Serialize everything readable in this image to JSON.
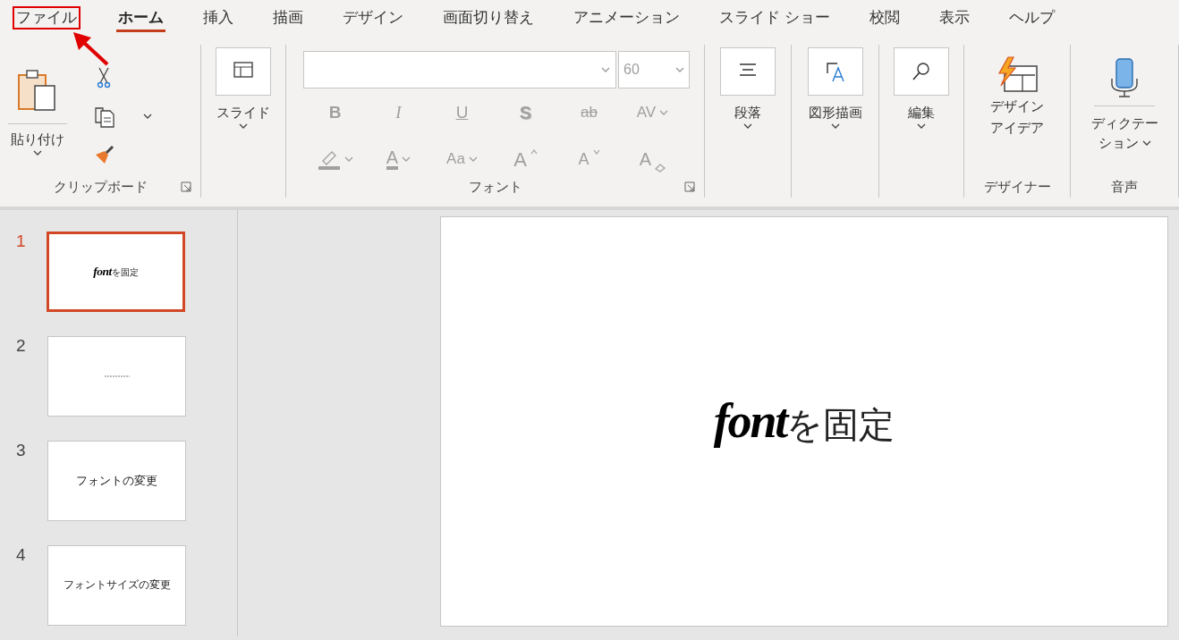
{
  "tabs": [
    {
      "label": "ファイル",
      "selected": false,
      "annotated": true
    },
    {
      "label": "ホーム",
      "selected": true,
      "annotated": false
    },
    {
      "label": "挿入",
      "selected": false,
      "annotated": false
    },
    {
      "label": "描画",
      "selected": false,
      "annotated": false
    },
    {
      "label": "デザイン",
      "selected": false,
      "annotated": false
    },
    {
      "label": "画面切り替え",
      "selected": false,
      "annotated": false
    },
    {
      "label": "アニメーション",
      "selected": false,
      "annotated": false
    },
    {
      "label": "スライド ショー",
      "selected": false,
      "annotated": false
    },
    {
      "label": "校閲",
      "selected": false,
      "annotated": false
    },
    {
      "label": "表示",
      "selected": false,
      "annotated": false
    },
    {
      "label": "ヘルプ",
      "selected": false,
      "annotated": false
    }
  ],
  "ribbon": [
    {
      "kind": "clipboard",
      "label": "クリップボード",
      "button": "貼り付け"
    },
    {
      "kind": "box",
      "button": "スライド"
    },
    {
      "kind": "font",
      "label": "フォント",
      "disabled": true,
      "font_size": "60",
      "row1": [
        {
          "glyph": "B",
          "kind": "bold",
          "dropdown": false
        },
        {
          "glyph": "I",
          "kind": "italic",
          "dropdown": false
        },
        {
          "glyph": "U",
          "kind": "underline",
          "dropdown": false
        },
        {
          "glyph": "S",
          "kind": "shadow",
          "dropdown": false
        },
        {
          "glyph": "ab",
          "kind": "strike",
          "dropdown": false
        },
        {
          "glyph": "AV",
          "kind": "spacing",
          "dropdown": true
        }
      ],
      "row2": [
        {
          "kind": "highlight",
          "dropdown": true
        },
        {
          "glyph": "A",
          "kind": "color",
          "dropdown": true
        },
        {
          "glyph": "Aa",
          "kind": "case",
          "dropdown": true
        },
        {
          "glyph": "A",
          "kind": "grow",
          "dropdown": false
        },
        {
          "glyph": "A",
          "kind": "shrink",
          "dropdown": false
        },
        {
          "glyph": "A",
          "kind": "clear",
          "dropdown": false
        }
      ]
    },
    {
      "kind": "box",
      "button": "段落"
    },
    {
      "kind": "box",
      "button": "図形描画"
    },
    {
      "kind": "box",
      "button": "編集"
    },
    {
      "kind": "designer",
      "label": "デザイナー",
      "button_lines": [
        "デザイン",
        "アイデア"
      ]
    },
    {
      "kind": "voice",
      "label": "音声",
      "button_lines": [
        "ディクテー",
        "ション"
      ]
    }
  ],
  "slides": [
    {
      "number": "1",
      "selected": true,
      "parts": [
        {
          "text": "font",
          "kind": "script"
        },
        {
          "text": "を固定",
          "kind": "plain"
        }
      ]
    },
    {
      "number": "2",
      "selected": false
    },
    {
      "number": "3",
      "selected": false,
      "parts": [
        {
          "text": "フォントの変更",
          "kind": "plain"
        }
      ]
    },
    {
      "number": "4",
      "selected": false,
      "parts": [
        {
          "text": "フォントサイズの変更",
          "kind": "plain"
        }
      ]
    }
  ],
  "main_slide": {
    "parts": [
      {
        "text": "font",
        "kind": "script"
      },
      {
        "text": "を固定",
        "kind": "plain"
      }
    ]
  }
}
